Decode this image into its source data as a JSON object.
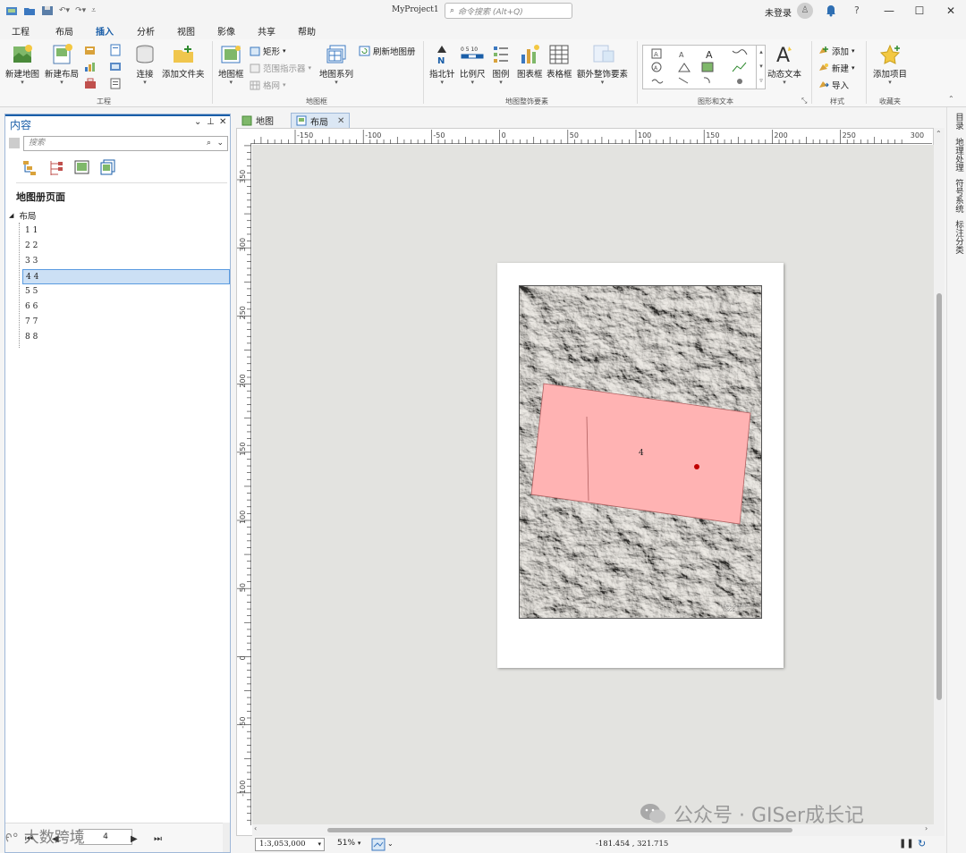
{
  "titlebar": {
    "project": "MyProject1",
    "search_placeholder": "命令搜索 (Alt+Q)",
    "login": "未登录",
    "help": "?"
  },
  "ribbon_tabs": [
    "工程",
    "布局",
    "插入",
    "分析",
    "视图",
    "影像",
    "共享",
    "帮助"
  ],
  "ribbon": {
    "new_map": "新建地图",
    "new_layout": "新建布局",
    "connect": "连接",
    "add_folder": "添加文件夹",
    "map_frame": "地图框",
    "rectangle": "矩形",
    "extent_indicator": "范围指示器",
    "grid": "格网",
    "map_series": "地图系列",
    "refresh_map_series": "刷新地图册",
    "north_arrow": "指北针",
    "scale_bar": "比例尺",
    "legend": "图例",
    "chart_frame": "图表框",
    "table_frame": "表格框",
    "extra_surround": "额外整饰要素",
    "dynamic_text": "动态文本",
    "add": "添加",
    "new": "新建",
    "import": "导入",
    "add_item": "添加项目",
    "group_project": "工程",
    "group_map_frames": "地图框",
    "group_map_surrounds": "地图整饰要素",
    "group_graphics_text": "图形和文本",
    "group_styles": "样式",
    "group_favorites": "收藏夹"
  },
  "contents": {
    "title": "内容",
    "search_placeholder": "搜索",
    "section": "地图册页面",
    "root": "布局",
    "items": [
      "1  1",
      "2  2",
      "3  3",
      "4  4",
      "5  5",
      "6  6",
      "7  7",
      "8  8"
    ],
    "selected_index": 3,
    "pager_value": "4"
  },
  "doc_tabs": {
    "map": "地图",
    "layout": "布局"
  },
  "ruler": {
    "h_labels": [
      "-150",
      "-100",
      "-50",
      "0",
      "50",
      "100",
      "150",
      "200",
      "250",
      "300"
    ],
    "v_labels": [
      "350",
      "300",
      "250",
      "200",
      "150",
      "100",
      "50",
      "0",
      "-50",
      "-100"
    ]
  },
  "map": {
    "page_label": "4",
    "polygon_fill": "#ffb3b3",
    "point_color": "#c00000",
    "credit": "Esri, Garmin, USGS..."
  },
  "status": {
    "scale": "1:3,053,000",
    "zoom": "51%",
    "coords": "-181.454 , 321.715"
  },
  "right_panel": [
    "目录",
    "地理处理",
    "符号系统",
    "标注分类"
  ],
  "watermarks": {
    "wechat": "公众号 · GISer成长记",
    "corner": "大数跨境"
  }
}
